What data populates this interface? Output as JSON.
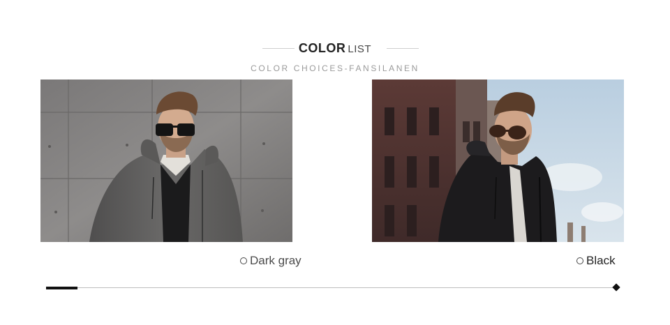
{
  "header": {
    "title_bold": "COLOR",
    "title_light": "LIST",
    "subtitle": "COLOR CHOICES-FANSILANEN"
  },
  "colors": [
    {
      "label": "Dark gray",
      "photo": "model-dark-gray-jacket",
      "swatch": "#5c5b5b"
    },
    {
      "label": "Black",
      "photo": "model-black-jacket",
      "swatch": "#1a1a1a"
    }
  ],
  "slider": {
    "progress_fraction": 0.055,
    "fill_color": "#111111",
    "track_color": "#bdbdbd"
  }
}
